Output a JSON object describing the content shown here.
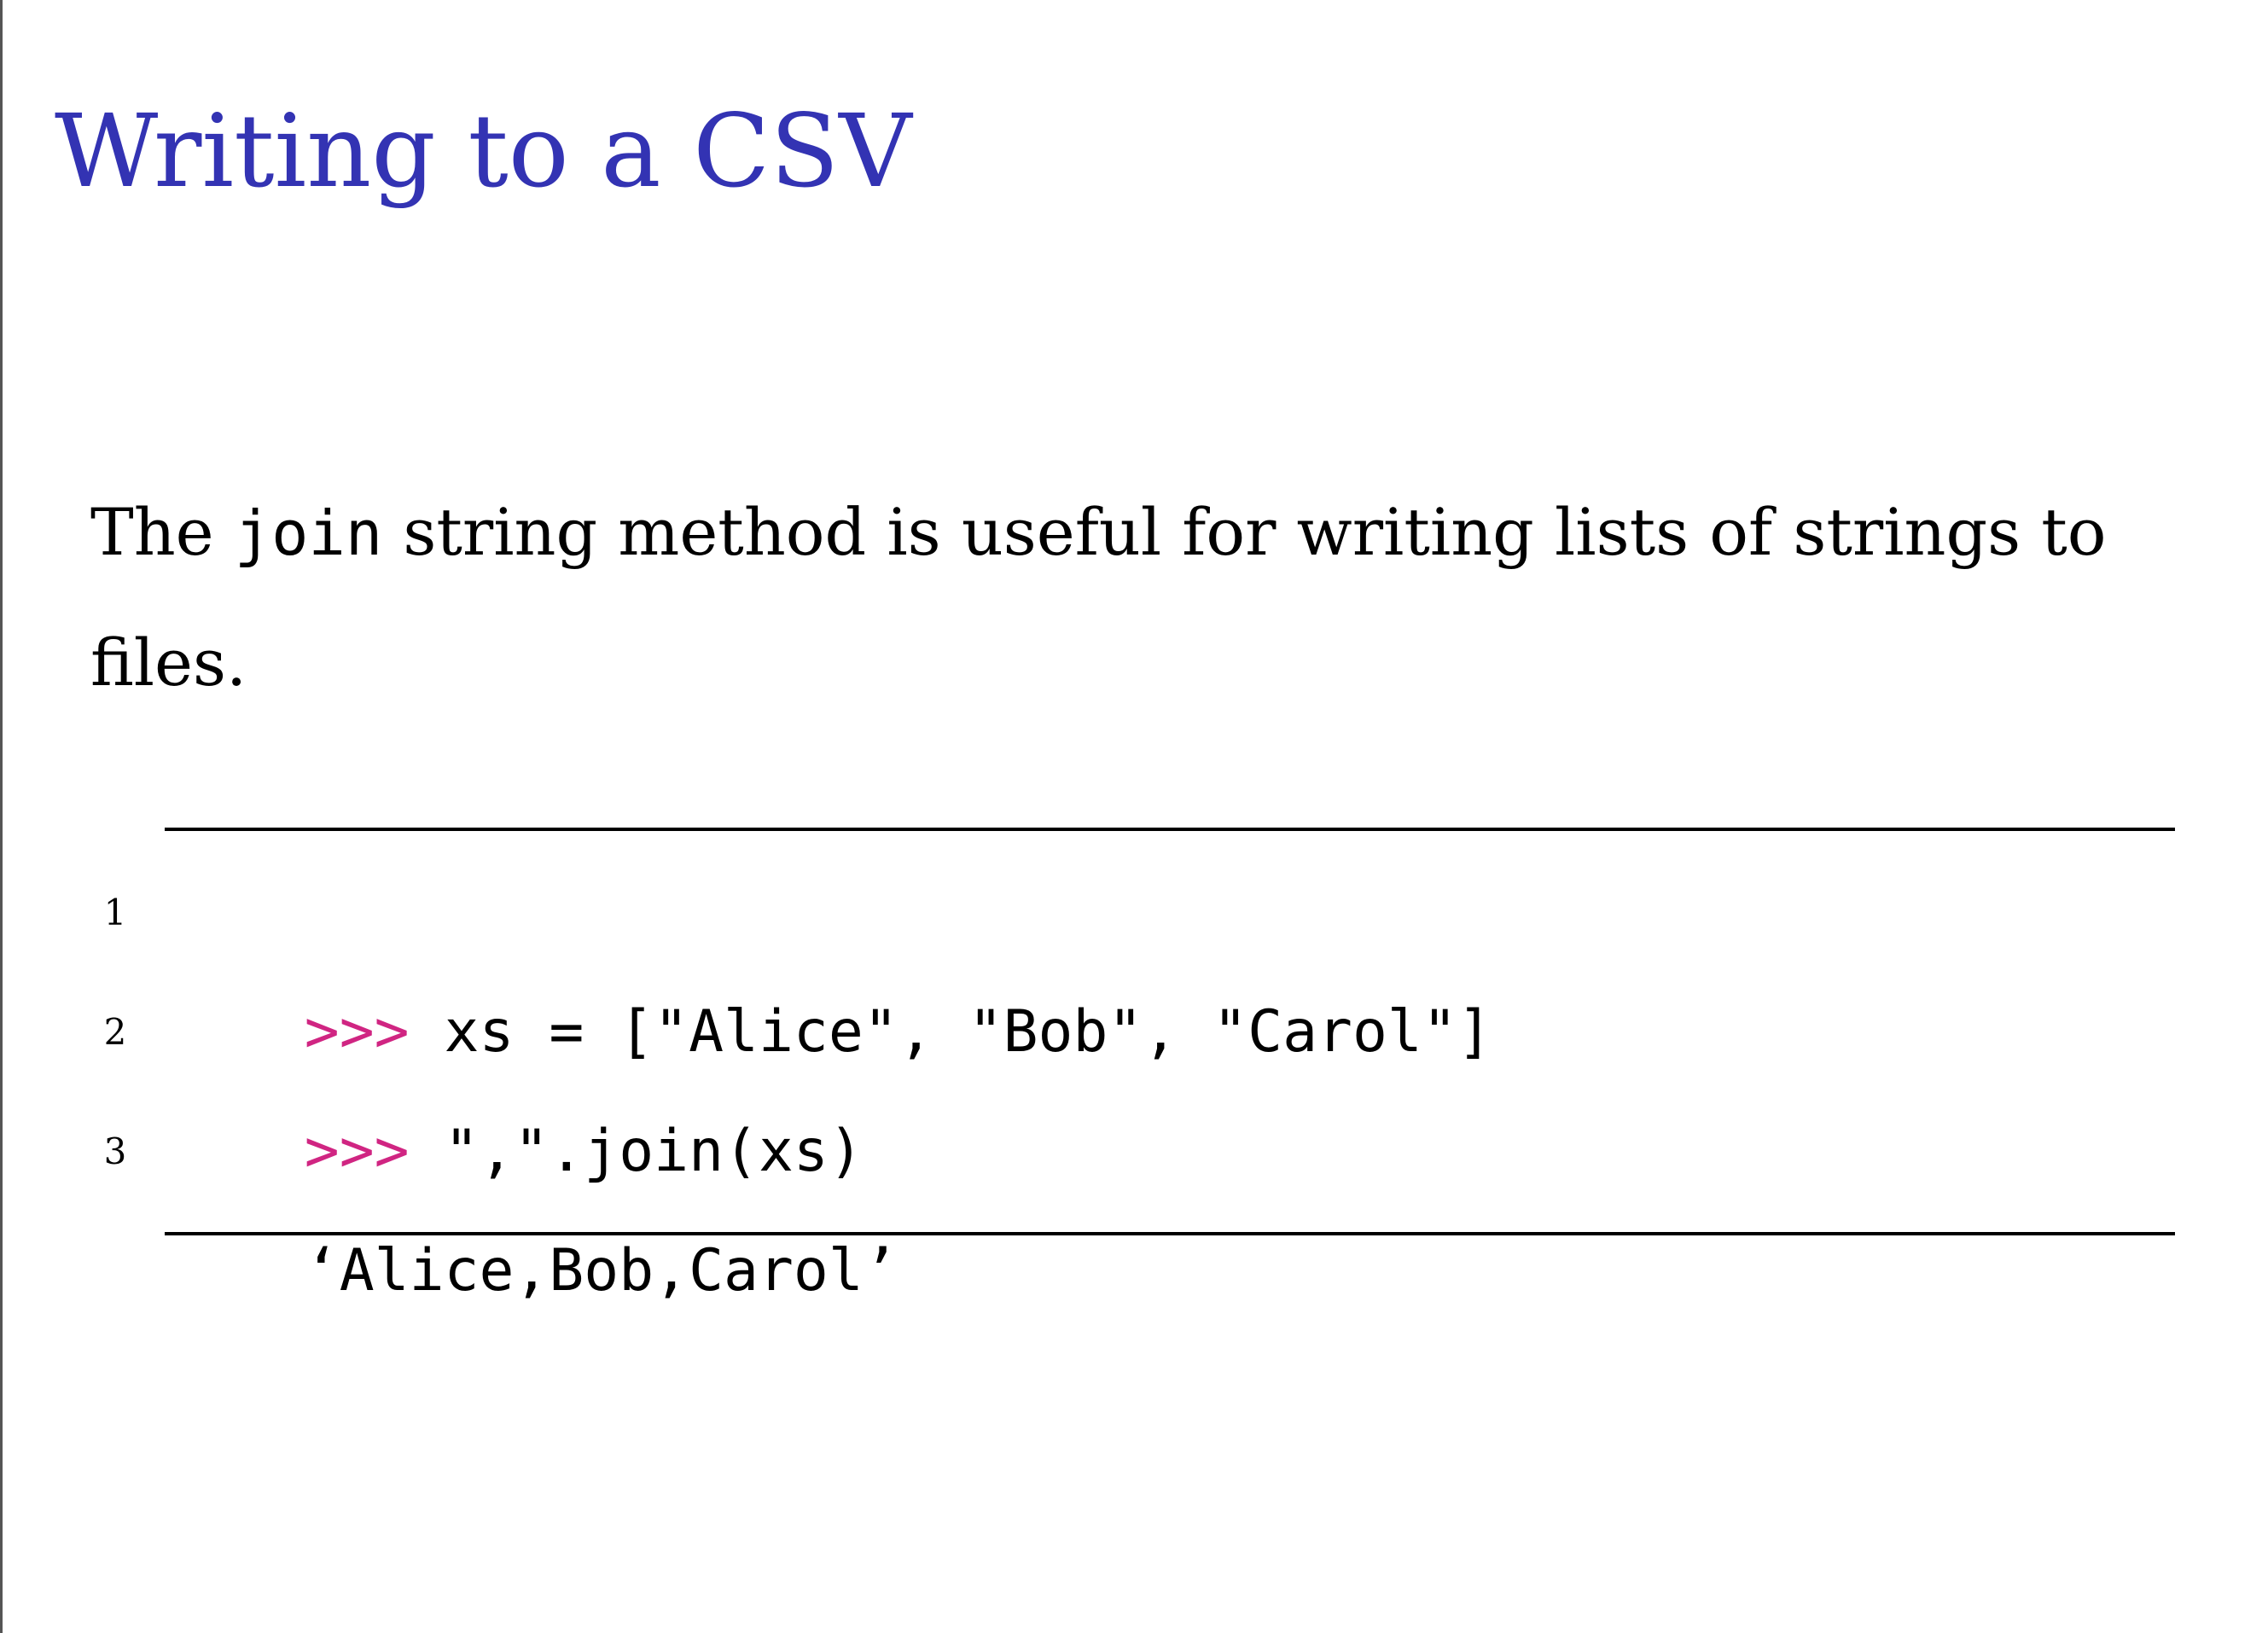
{
  "slide": {
    "title": "Writing to a CSV",
    "title_color": "#3333b3",
    "body": {
      "text_before": "The ",
      "code_word": "join",
      "text_after": " string method is useful for writing lists of strings to files."
    },
    "code": {
      "prompt_color": "#d02582",
      "lines": [
        {
          "number": "1",
          "prompt": ">>>",
          "code": " xs = [\"Alice\", \"Bob\", \"Carol\"]"
        },
        {
          "number": "2",
          "prompt": ">>>",
          "code": " \",\".join(xs)"
        },
        {
          "number": "3",
          "prompt": "",
          "code": "‘Alice,Bob,Carol’"
        }
      ]
    }
  }
}
